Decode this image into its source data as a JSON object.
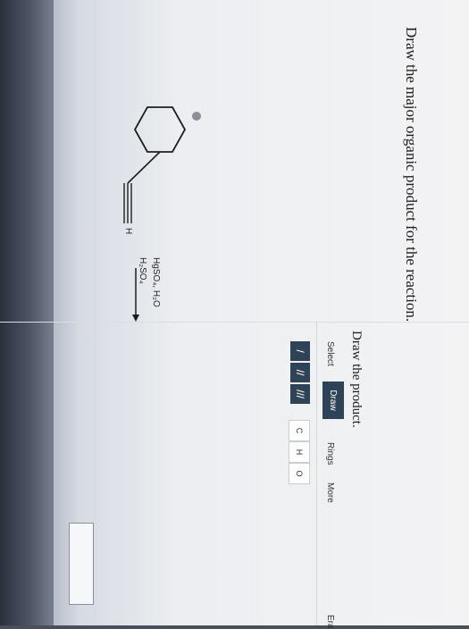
{
  "question": {
    "title": "Draw the major organic product for the reaction."
  },
  "reaction": {
    "reagent_line_1": "HgSO₄, H₂O",
    "reagent_line_2": "H₂SO₄",
    "terminal_atom": "H"
  },
  "editor": {
    "title": "Draw the product.",
    "tabs": {
      "select": "Select",
      "draw": "Draw",
      "rings": "Rings",
      "more": "More",
      "erase": "Era"
    },
    "tools": {
      "single_bond": "/",
      "double_bond": "//",
      "triple_bond": "///",
      "atom_c": "C",
      "atom_h": "H",
      "atom_o": "O"
    }
  },
  "colors": {
    "accent": "#2f4356",
    "text": "#1d1d1d"
  }
}
